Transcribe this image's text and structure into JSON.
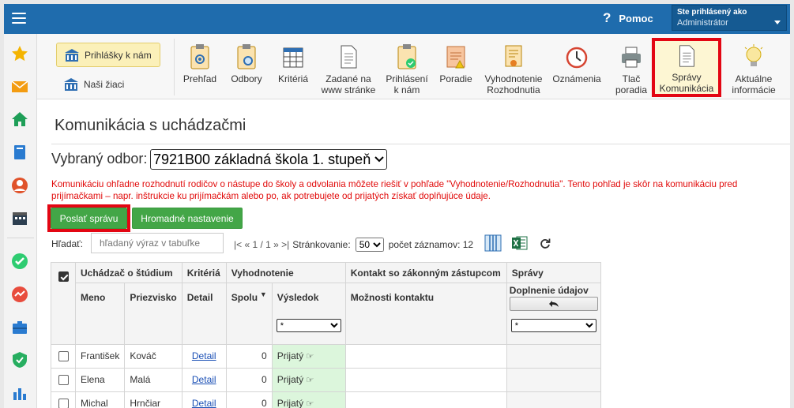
{
  "topbar": {
    "help_label": "Pomoc",
    "help_icon": "?",
    "user_line1": "Ste prihlásený ako",
    "user_line2": "Administrátor"
  },
  "ribbon": {
    "left_primary": "Prihlášky k nám",
    "left_secondary": "Naši žiaci",
    "tools": [
      {
        "label": "Prehľad"
      },
      {
        "label": "Odbory"
      },
      {
        "label": "Kritériá"
      },
      {
        "label": "Zadané na\nwww stránke"
      },
      {
        "label": "Prihlásení\nk nám"
      },
      {
        "label": "Poradie"
      },
      {
        "label": "Vyhodnotenie\nRozhodnutia"
      },
      {
        "label": "Oznámenia"
      },
      {
        "label": "Tlač\nporadia"
      },
      {
        "label": "Správy\nKomunikácia"
      },
      {
        "label": "Aktuálne\ninformácie"
      }
    ]
  },
  "page": {
    "title": "Komunikácia s uchádzačmi",
    "branch_label": "Vybraný odbor:",
    "branch_value": "7921B00 základná škola 1. stupeň",
    "notice": "Komunikáciu ohľadne rozhodnutí rodičov o nástupe do školy a odvolania môžete riešiť v pohľade \"Vyhodnotenie/Rozhodnutia\". Tento pohľad je skôr na komunikáciu pred prijímačkami – napr. inštrukcie ku prijímačkám alebo po, ak potrebujete od prijatých získať doplňujúce údaje.",
    "send_button": "Poslať správu",
    "bulk_button": "Hromadné nastavenie",
    "search_label": "Hľadať:",
    "search_placeholder": "hľadaný výraz v tabuľke",
    "pager_text": "|< « 1 / 1 » >|",
    "pager_label": "Stránkovanie:",
    "page_size": "50",
    "records_label": "počet záznamov: 12"
  },
  "table": {
    "group_headers": {
      "applicant": "Uchádzač o štúdium",
      "criteria": "Kritériá",
      "evaluation": "Vyhodnotenie",
      "contact": "Kontakt so zákonným zástupcom",
      "messages": "Správy"
    },
    "sub_headers": {
      "first_name": "Meno",
      "last_name": "Priezvisko",
      "detail": "Detail",
      "total": "Spolu",
      "result": "Výsledok",
      "contact_options": "Možnosti kontaktu",
      "completion": "Doplnenie údajov"
    },
    "filter_value": "*",
    "rows": [
      {
        "first": "František",
        "last": "Kováč",
        "detail": "Detail",
        "total": "0",
        "result": "Prijatý"
      },
      {
        "first": "Elena",
        "last": "Malá",
        "detail": "Detail",
        "total": "0",
        "result": "Prijatý"
      },
      {
        "first": "Michal",
        "last": "Hrnčiar",
        "detail": "Detail",
        "total": "0",
        "result": "Prijatý"
      }
    ]
  },
  "colors": {
    "topbar": "#1f6cad",
    "accent_green": "#43a647",
    "highlight_red": "#e30613",
    "notice_red": "#e10a0a",
    "result_green": "#dcf6dc"
  }
}
